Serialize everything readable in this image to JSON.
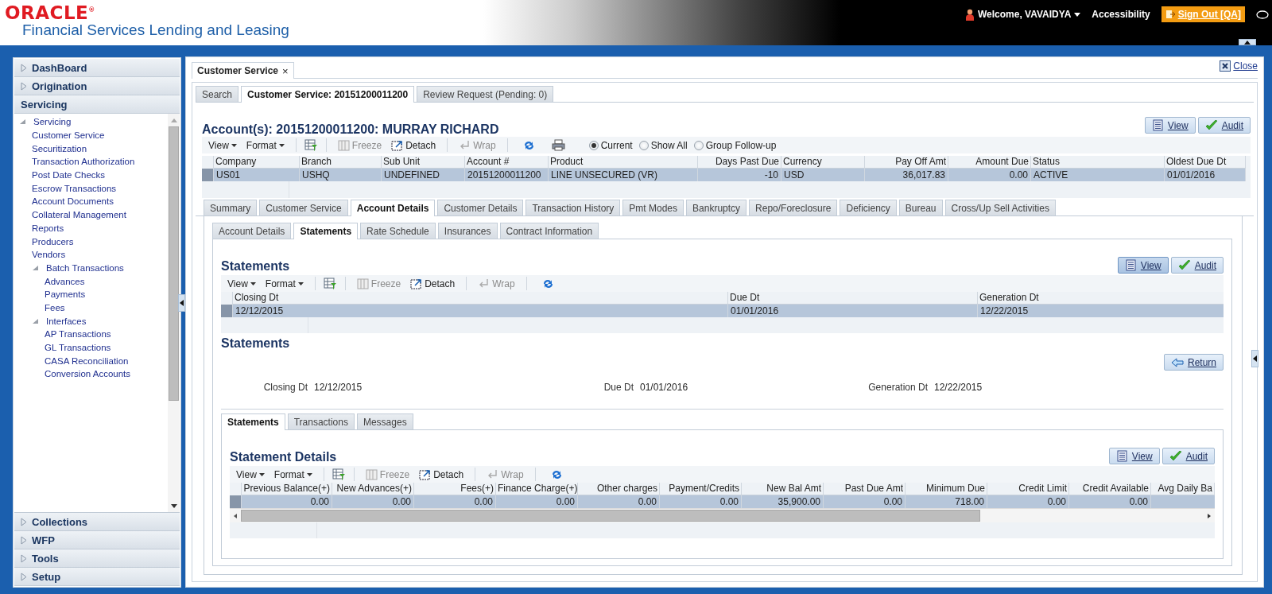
{
  "header": {
    "logo": "ORACLE",
    "logo_mark": "®",
    "app_title": "Financial Services Lending and Leasing",
    "user": "Welcome, VAVAIDYA",
    "accessibility": "Accessibility",
    "sign_out": "Sign Out [QA]"
  },
  "sidebar": {
    "sections": [
      {
        "label": "DashBoard",
        "expanded": false
      },
      {
        "label": "Origination",
        "expanded": false
      },
      {
        "label": "Servicing",
        "expanded": true,
        "tree": [
          {
            "label": "Servicing",
            "expanded": true,
            "children": [
              {
                "label": "Customer Service"
              },
              {
                "label": "Securitization"
              },
              {
                "label": "Transaction Authorization"
              },
              {
                "label": "Post Date Checks"
              },
              {
                "label": "Escrow Transactions"
              },
              {
                "label": "Account Documents"
              },
              {
                "label": "Collateral Management"
              },
              {
                "label": "Reports"
              },
              {
                "label": "Producers"
              },
              {
                "label": "Vendors"
              },
              {
                "label": "Batch Transactions",
                "expanded": true,
                "children": [
                  {
                    "label": "Advances"
                  },
                  {
                    "label": "Payments"
                  },
                  {
                    "label": "Fees"
                  }
                ]
              },
              {
                "label": "Interfaces",
                "expanded": true,
                "children": [
                  {
                    "label": "AP Transactions"
                  },
                  {
                    "label": "GL Transactions"
                  },
                  {
                    "label": "CASA Reconciliation"
                  },
                  {
                    "label": "Conversion Accounts"
                  }
                ]
              }
            ]
          }
        ]
      },
      {
        "label": "Collections",
        "expanded": false
      },
      {
        "label": "WFP",
        "expanded": false
      },
      {
        "label": "Tools",
        "expanded": false
      },
      {
        "label": "Setup",
        "expanded": false
      }
    ]
  },
  "main": {
    "page_tab": {
      "label": "Customer Service",
      "close": "×"
    },
    "close_link": "Close",
    "tabs": [
      {
        "label": "Search",
        "selected": false
      },
      {
        "label": "Customer Service: 20151200011200",
        "selected": true
      },
      {
        "label": "Review Request (Pending: 0)",
        "selected": false
      }
    ],
    "account": {
      "title": "Account(s): 20151200011200: MURRAY RICHARD",
      "actions": [
        {
          "kind": "view",
          "label": "View",
          "selected": false
        },
        {
          "kind": "audit",
          "label": "Audit",
          "selected": false
        }
      ],
      "toolbar": {
        "menus": [
          "View",
          "Format"
        ],
        "buttons": [
          {
            "kind": "freeze",
            "label": "Freeze",
            "disabled": true
          },
          {
            "kind": "detach",
            "label": "Detach",
            "disabled": false
          },
          {
            "kind": "wrap",
            "label": "Wrap",
            "disabled": true
          }
        ],
        "tools": [
          {
            "kind": "refresh"
          },
          {
            "kind": "print"
          }
        ]
      },
      "radios": [
        {
          "label": "Current",
          "selected": true
        },
        {
          "label": "Show All",
          "selected": false
        },
        {
          "label": "Group Follow-up",
          "selected": false
        }
      ],
      "table": {
        "columns": [
          {
            "label": "Company",
            "numeric": false
          },
          {
            "label": "Branch",
            "numeric": false
          },
          {
            "label": "Sub Unit",
            "numeric": false
          },
          {
            "label": "Account #",
            "numeric": false
          },
          {
            "label": "Product",
            "numeric": false
          },
          {
            "label": "Days Past Due",
            "numeric": true
          },
          {
            "label": "Currency",
            "numeric": false
          },
          {
            "label": "Pay Off Amt",
            "numeric": true
          },
          {
            "label": "Amount Due",
            "numeric": true
          },
          {
            "label": "Status",
            "numeric": false
          },
          {
            "label": "Oldest Due Dt",
            "numeric": false
          }
        ],
        "rows": [
          {
            "selected": true,
            "cells": [
              "US01",
              "USHQ",
              "UNDEFINED",
              "20151200011200",
              "LINE UNSECURED (VR)",
              "-10",
              "USD",
              "36,017.83",
              "0.00",
              "ACTIVE",
              "01/01/2016"
            ]
          }
        ]
      }
    },
    "detail_tabs": [
      {
        "label": "Summary",
        "selected": false
      },
      {
        "label": "Customer Service",
        "selected": false
      },
      {
        "label": "Account Details",
        "selected": true
      },
      {
        "label": "Customer Details",
        "selected": false
      },
      {
        "label": "Transaction History",
        "selected": false
      },
      {
        "label": "Pmt Modes",
        "selected": false
      },
      {
        "label": "Bankruptcy",
        "selected": false
      },
      {
        "label": "Repo/Foreclosure",
        "selected": false
      },
      {
        "label": "Deficiency",
        "selected": false
      },
      {
        "label": "Bureau",
        "selected": false
      },
      {
        "label": "Cross/Up Sell Activities",
        "selected": false
      }
    ],
    "sub_tabs": [
      {
        "label": "Account Details",
        "selected": false
      },
      {
        "label": "Statements",
        "selected": true
      },
      {
        "label": "Rate Schedule",
        "selected": false
      },
      {
        "label": "Insurances",
        "selected": false
      },
      {
        "label": "Contract Information",
        "selected": false
      }
    ],
    "statements": {
      "title": "Statements",
      "actions": [
        {
          "kind": "view",
          "label": "View",
          "selected": true
        },
        {
          "kind": "audit",
          "label": "Audit",
          "selected": false
        }
      ],
      "toolbar": {
        "menus": [
          "View",
          "Format"
        ],
        "buttons": [
          {
            "kind": "freeze",
            "label": "Freeze",
            "disabled": true
          },
          {
            "kind": "detach",
            "label": "Detach",
            "disabled": false
          },
          {
            "kind": "wrap",
            "label": "Wrap",
            "disabled": true
          }
        ],
        "tools": [
          {
            "kind": "refresh"
          }
        ]
      },
      "table": {
        "columns": [
          {
            "label": "Closing Dt",
            "numeric": false
          },
          {
            "label": "Due Dt",
            "numeric": false
          },
          {
            "label": "Generation Dt",
            "numeric": false
          }
        ],
        "rows": [
          {
            "selected": true,
            "cells": [
              "12/12/2015",
              "01/01/2016",
              "12/22/2015"
            ]
          }
        ]
      }
    },
    "statement_view": {
      "title": "Statements",
      "return": "Return",
      "fields": [
        {
          "label": "Closing Dt",
          "value": "12/12/2015"
        },
        {
          "label": "Due Dt",
          "value": "01/01/2016"
        },
        {
          "label": "Generation Dt",
          "value": "12/22/2015"
        }
      ]
    },
    "lower_tabs": [
      {
        "label": "Statements",
        "selected": true
      },
      {
        "label": "Transactions",
        "selected": false
      },
      {
        "label": "Messages",
        "selected": false
      }
    ],
    "statement_details": {
      "title": "Statement Details",
      "actions": [
        {
          "kind": "view",
          "label": "View",
          "selected": false
        },
        {
          "kind": "audit",
          "label": "Audit",
          "selected": false
        }
      ],
      "toolbar": {
        "menus": [
          "View",
          "Format"
        ],
        "buttons": [
          {
            "kind": "freeze",
            "label": "Freeze",
            "disabled": true
          },
          {
            "kind": "detach",
            "label": "Detach",
            "disabled": false
          },
          {
            "kind": "wrap",
            "label": "Wrap",
            "disabled": true
          }
        ],
        "tools": [
          {
            "kind": "refresh"
          }
        ]
      },
      "table": {
        "columns": [
          {
            "label": "Previous Balance(+)",
            "numeric": true
          },
          {
            "label": "New Advances(+)",
            "numeric": true
          },
          {
            "label": "Fees(+)",
            "numeric": true
          },
          {
            "label": "Finance Charge(+)",
            "numeric": true
          },
          {
            "label": "Other charges",
            "numeric": true
          },
          {
            "label": "Payment/Credits",
            "numeric": true
          },
          {
            "label": "New Bal Amt",
            "numeric": true
          },
          {
            "label": "Past Due Amt",
            "numeric": true
          },
          {
            "label": "Minimum Due",
            "numeric": true
          },
          {
            "label": "Credit Limit",
            "numeric": true
          },
          {
            "label": "Credit Available",
            "numeric": true
          },
          {
            "label": "Avg Daily Ba",
            "numeric": true
          }
        ],
        "rows": [
          {
            "selected": true,
            "cells": [
              "0.00",
              "0.00",
              "0.00",
              "0.00",
              "0.00",
              "0.00",
              "35,900.00",
              "0.00",
              "718.00",
              "0.00",
              "0.00"
            ]
          }
        ]
      }
    }
  }
}
